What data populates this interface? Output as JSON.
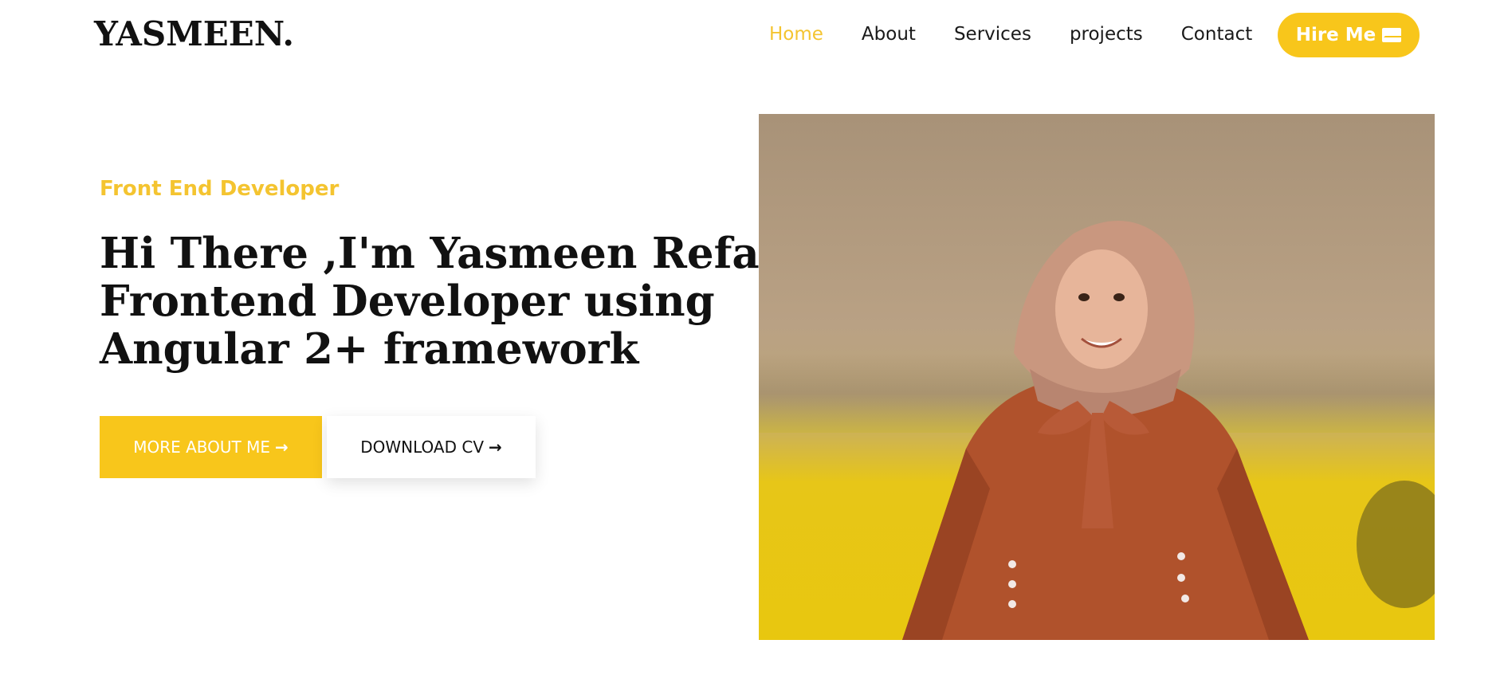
{
  "header": {
    "logo": "YASMEEN.",
    "nav": [
      {
        "label": "Home",
        "active": true
      },
      {
        "label": "About",
        "active": false
      },
      {
        "label": "Services",
        "active": false
      },
      {
        "label": "projects",
        "active": false
      },
      {
        "label": "Contact",
        "active": false
      }
    ],
    "hire_label": "Hire Me"
  },
  "hero": {
    "subtitle": "Front End Developer",
    "headline_lines": [
      "Hi There ,I'm Yasmeen Refay",
      "Frontend Developer using",
      "Angular 2+ framework"
    ],
    "primary_button": "MORE ABOUT ME",
    "secondary_button": "DOWNLOAD CV"
  },
  "colors": {
    "accent": "#f8c61b",
    "text": "#111111"
  },
  "icons": {
    "hire": "envelope-icon",
    "arrow": "arrow-right-icon"
  }
}
